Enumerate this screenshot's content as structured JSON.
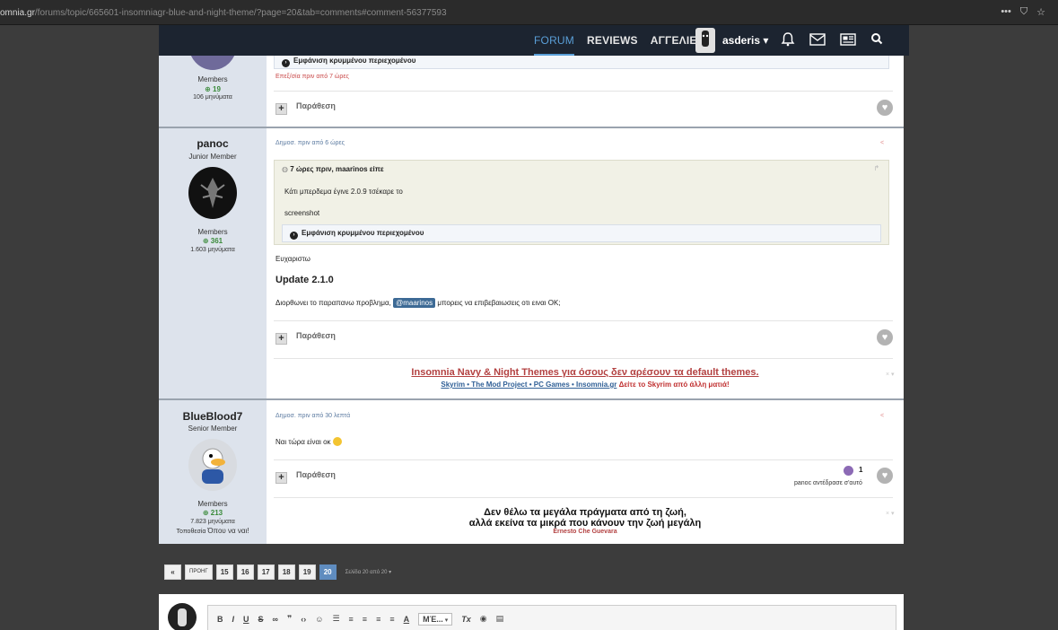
{
  "browser": {
    "url_host": "omnia.gr",
    "url_path": "/forums/topic/665601-insomniagr-blue-and-night-theme/?page=20&tab=comments#comment-56377593",
    "tools": [
      "•••",
      "⛉",
      "☆"
    ]
  },
  "nav": {
    "links": [
      "FORUM",
      "REVIEWS",
      "ΑΓΓΕΛΙΕΣ"
    ],
    "username": "asderis",
    "caret": "▾"
  },
  "post0": {
    "author_group": "Members",
    "author_rep": "19",
    "author_posts": "106 μηνύματα",
    "spoiler": "Εμφάνιση κρυμμένου περιεχομένου",
    "edited": "Επεξ/σία πριν από 7 ώρες",
    "quote_label": "Παράθεση"
  },
  "post1": {
    "author_name": "panoc",
    "author_rank": "Junior Member",
    "author_group": "Members",
    "author_rep": "361",
    "author_posts": "1.603 μηνύματα",
    "meta": "Δημοσ. πριν από 6 ώρες",
    "quote_header": "7 ώρες πριν, maarinos είπε",
    "quote_line1": "Κάτι μπερδεμα έγινε 2.0.9 τσέκαρε το",
    "quote_line2": "screenshot",
    "spoiler": "Εμφάνιση κρυμμένου περιεχομένου",
    "thanks": "Ευχαριστω",
    "heading": "Update 2.1.0",
    "body_before": "Διορθωνει το παραπανω προβλημα,",
    "mention": "@maarinos",
    "body_after": "μπορεις να επιβεβαιωσεις οτι ειναι ΟΚ;",
    "quote_label": "Παράθεση",
    "sig_title": "Insomnia Navy & Night Themes για όσους δεν αρέσουν τα default themes.",
    "sig_links": "Skyrim • The Mod Project • PC Games • Insomnia.gr",
    "sig_red": "Δείτε το Skyrim από άλλη ματιά!"
  },
  "post2": {
    "author_name": "BlueBlood7",
    "author_rank": "Senior Member",
    "author_group": "Members",
    "author_rep": "213",
    "author_posts": "7.823 μηνύματα",
    "author_location_label": "Τοποθεσία",
    "author_location": "Όπου να ναι!",
    "meta": "Δημοσ. πριν από 30 λεπτά",
    "body": "Ναι τώρα είναι οκ",
    "quote_label": "Παράθεση",
    "reaction_count": "1",
    "reaction_text": "panoc αντέδρασε σ'αυτό",
    "sig_line1": "Δεν θέλω τα μεγάλα πράγματα από τη ζωή,",
    "sig_line2": "αλλά εκείνα τα μικρά που κάνουν την ζωή μεγάλη",
    "sig_author": "Ernesto Che Guevara"
  },
  "pagination": {
    "first": "«",
    "prev": "ΠΡΟΗΓ",
    "pages": [
      "15",
      "16",
      "17",
      "18",
      "19",
      "20"
    ],
    "active_page": "20",
    "info": "Σελίδα 20 από 20 ▾"
  },
  "editor": {
    "format_select": "ΜΈ..."
  },
  "colors": {
    "nav_bg": "#1c2430",
    "author_bg": "#dde3ec",
    "accent": "#5a9fd8",
    "sig_red": "#b34141"
  }
}
